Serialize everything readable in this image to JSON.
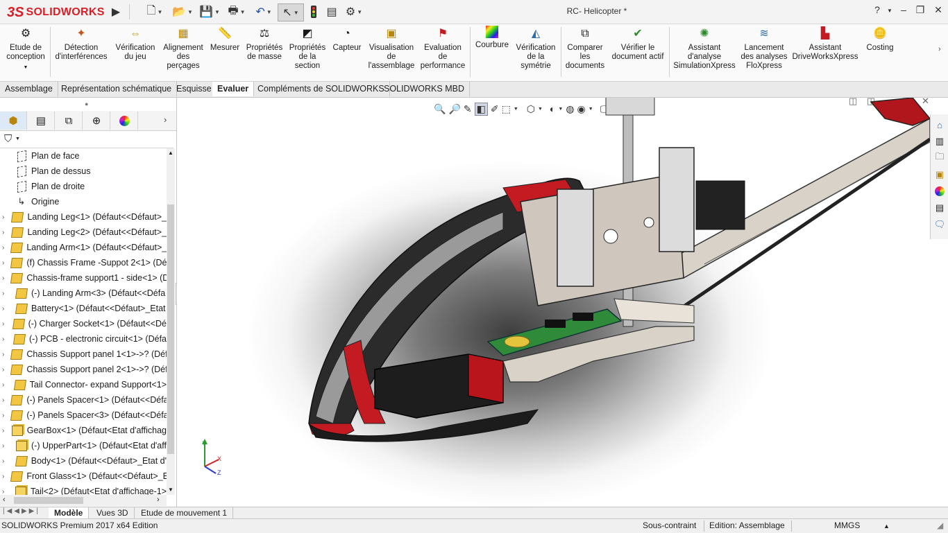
{
  "app": {
    "brand": "SOLIDWORKS",
    "document_title": "RC- Helicopter *"
  },
  "title_bar": {
    "help": "?",
    "minimize": "–",
    "restore": "❐",
    "close": "✕"
  },
  "ribbon": {
    "items": [
      {
        "label": "Etude de\nconception"
      },
      {
        "label": "Détection\nd'interférences"
      },
      {
        "label": "Vérification\ndu jeu"
      },
      {
        "label": "Alignement\ndes\nperçages"
      },
      {
        "label": "Mesurer"
      },
      {
        "label": "Propriétés\nde masse"
      },
      {
        "label": "Propriétés\nde la\nsection"
      },
      {
        "label": "Capteur"
      },
      {
        "label": "Visualisation\nde\nl'assemblage"
      },
      {
        "label": "Evaluation\nde\nperformance"
      },
      {
        "label": "Courbure"
      },
      {
        "label": "Vérification\nde la\nsymétrie"
      },
      {
        "label": "Comparer\nles\ndocuments"
      },
      {
        "label": "Vérifier le\ndocument actif"
      },
      {
        "label": "Assistant\nd'analyse\nSimulationXpress"
      },
      {
        "label": "Lancement\ndes analyses\nFloXpress"
      },
      {
        "label": "Assistant\nDriveWorksXpress"
      },
      {
        "label": "Costing"
      }
    ]
  },
  "command_tabs": [
    "Assemblage",
    "Représentation schématique",
    "Esquisse",
    "Evaluer",
    "Compléments de SOLIDWORKS",
    "SOLIDWORKS MBD"
  ],
  "active_command_tab": "Evaluer",
  "tree": [
    {
      "label": "Plan de face",
      "kind": "plane"
    },
    {
      "label": "Plan de dessus",
      "kind": "plane"
    },
    {
      "label": "Plan de droite",
      "kind": "plane"
    },
    {
      "label": "Origine",
      "kind": "origin"
    },
    {
      "label": "Landing Leg<1> (Défaut<<Défaut>_",
      "kind": "part"
    },
    {
      "label": "Landing Leg<2> (Défaut<<Défaut>_",
      "kind": "part"
    },
    {
      "label": "Landing Arm<1> (Défaut<<Défaut>_",
      "kind": "part"
    },
    {
      "label": "(f) Chassis Frame -Suppot 2<1> (Déf",
      "kind": "part"
    },
    {
      "label": "Chassis-frame support1 - side<1> (D",
      "kind": "part"
    },
    {
      "label": "(-) Landing Arm<3> (Défaut<<Défa",
      "kind": "part"
    },
    {
      "label": "Battery<1> (Défaut<<Défaut>_Etat",
      "kind": "part"
    },
    {
      "label": "(-) Charger Socket<1> (Défaut<<Dé",
      "kind": "part"
    },
    {
      "label": "(-) PCB -  electronic circuit<1> (Défa",
      "kind": "part"
    },
    {
      "label": "Chassis Support panel 1<1>->? (Déf",
      "kind": "part"
    },
    {
      "label": "Chassis Support panel 2<1>->? (Déf",
      "kind": "part"
    },
    {
      "label": "Tail Connector- expand Support<1>",
      "kind": "part"
    },
    {
      "label": "(-) Panels Spacer<1> (Défaut<<Défa",
      "kind": "part"
    },
    {
      "label": "(-) Panels Spacer<3> (Défaut<<Défa",
      "kind": "part"
    },
    {
      "label": "GearBox<1> (Défaut<Etat d'affichag",
      "kind": "asm"
    },
    {
      "label": "(-) UpperPart<1> (Défaut<Etat d'aff",
      "kind": "asm"
    },
    {
      "label": "Body<1> (Défaut<<Défaut>_Etat d'",
      "kind": "part"
    },
    {
      "label": "Front Glass<1> (Défaut<<Défaut>_E",
      "kind": "part"
    },
    {
      "label": "Tail<2> (Défaut<Etat d'affichage-1>",
      "kind": "asm"
    }
  ],
  "bottom_tabs": [
    "Modèle",
    "Vues 3D",
    "Etude de mouvement 1"
  ],
  "active_bottom_tab": "Modèle",
  "status": {
    "edition": "SOLIDWORKS Premium 2017 x64 Edition",
    "constraint": "Sous-contraint",
    "mode": "Edition: Assemblage",
    "units": "MMGS"
  },
  "axes": {
    "x": "X",
    "y": "Y",
    "z": "Z"
  },
  "colors": {
    "brand": "#d91f26",
    "body_red": "#c41b22",
    "pcb": "#2f8a3a"
  }
}
